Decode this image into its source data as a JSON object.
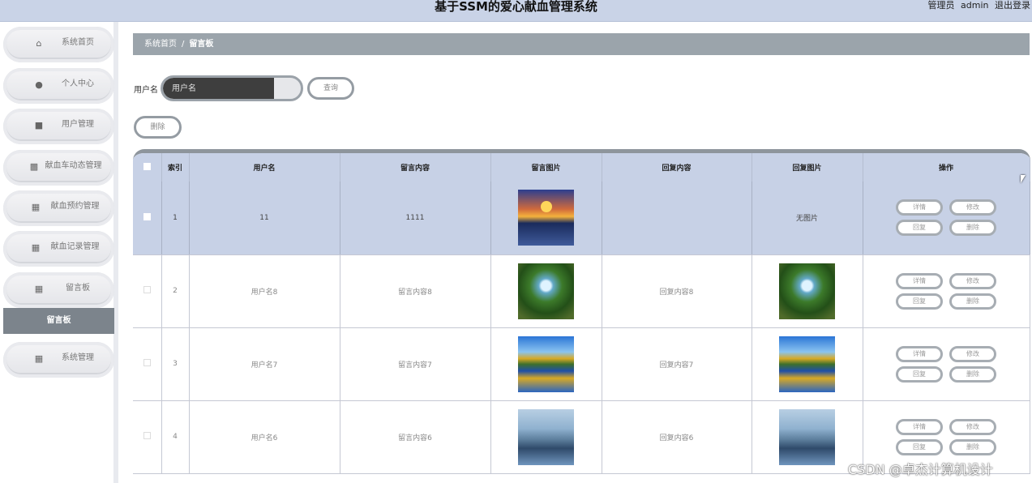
{
  "header": {
    "title": "基于SSM的爱心献血管理系统",
    "role": "管理员",
    "username": "admin",
    "logout": "退出登录"
  },
  "sidebar": {
    "items": [
      {
        "label": "系统首页",
        "icon": "home-icon"
      },
      {
        "label": "个人中心",
        "icon": "user-icon"
      },
      {
        "label": "用户管理",
        "icon": "monitor-icon"
      },
      {
        "label": "献血车动态管理",
        "icon": "chart-icon"
      },
      {
        "label": "献血预约管理",
        "icon": "grid-icon"
      },
      {
        "label": "献血记录管理",
        "icon": "grid-icon"
      },
      {
        "label": "留言板",
        "icon": "grid-icon"
      },
      {
        "label": "系统管理",
        "icon": "grid-icon"
      }
    ],
    "submenu_active": "留言板"
  },
  "breadcrumb": {
    "home": "系统首页",
    "separator": "/",
    "current": "留言板"
  },
  "search": {
    "label": "用户名",
    "placeholder": "用户名",
    "button": "查询"
  },
  "actions": {
    "delete": "删除"
  },
  "table": {
    "headers": [
      "索引",
      "用户名",
      "留言内容",
      "留言图片",
      "回复内容",
      "回复图片",
      "操作"
    ],
    "rows": [
      {
        "index": "1",
        "username": "11",
        "content": "1111",
        "image": "sunset",
        "reply": "",
        "reply_image": "无图片"
      },
      {
        "index": "2",
        "username": "用户名8",
        "content": "留言内容8",
        "image": "forest",
        "reply": "回复内容8",
        "reply_image": "forest"
      },
      {
        "index": "3",
        "username": "用户名7",
        "content": "留言内容7",
        "image": "lake",
        "reply": "回复内容7",
        "reply_image": "lake"
      },
      {
        "index": "4",
        "username": "用户名6",
        "content": "留言内容6",
        "image": "dusk",
        "reply": "回复内容6",
        "reply_image": "dusk"
      }
    ],
    "row_buttons": {
      "detail": "详情",
      "edit": "修改",
      "reply": "回复",
      "delete": "删除"
    }
  },
  "watermark": "CSDN @卓杰计算机设计"
}
